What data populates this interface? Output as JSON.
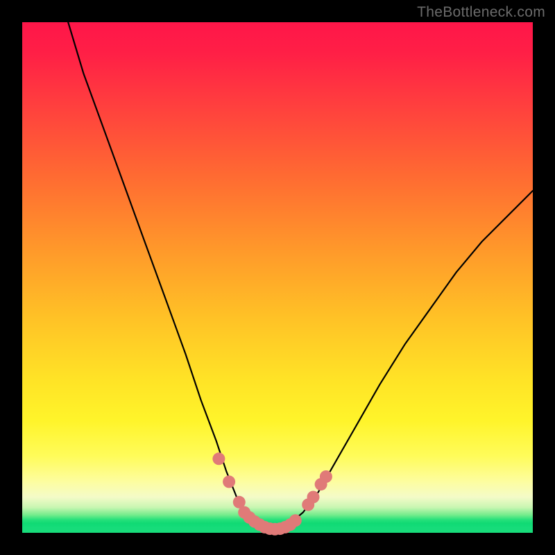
{
  "watermark": "TheBottleneck.com",
  "chart_data": {
    "type": "line",
    "title": "",
    "xlabel": "",
    "ylabel": "",
    "xlim": [
      0,
      100
    ],
    "ylim": [
      0,
      100
    ],
    "grid": false,
    "legend": false,
    "series": [
      {
        "name": "bottleneck-curve",
        "x": [
          9,
          12,
          16,
          20,
          24,
          28,
          32,
          35,
          38,
          40,
          42,
          44,
          46,
          48,
          50,
          52,
          55,
          58,
          62,
          66,
          70,
          75,
          80,
          85,
          90,
          95,
          100
        ],
        "values": [
          100,
          90,
          79,
          68,
          57,
          46,
          35,
          26,
          18,
          12,
          7,
          3.5,
          1.5,
          0.6,
          0.6,
          1.5,
          4,
          8,
          15,
          22,
          29,
          37,
          44,
          51,
          57,
          62,
          67
        ]
      }
    ],
    "markers": {
      "name": "highlighted-points",
      "color": "#e07a78",
      "points": [
        {
          "x": 38.5,
          "y": 14.5
        },
        {
          "x": 40.5,
          "y": 10
        },
        {
          "x": 42.5,
          "y": 6
        },
        {
          "x": 43.5,
          "y": 4
        },
        {
          "x": 44.5,
          "y": 3
        },
        {
          "x": 45.5,
          "y": 2.2
        },
        {
          "x": 46.5,
          "y": 1.6
        },
        {
          "x": 47.5,
          "y": 1.1
        },
        {
          "x": 48.5,
          "y": 0.8
        },
        {
          "x": 49.5,
          "y": 0.7
        },
        {
          "x": 50.5,
          "y": 0.8
        },
        {
          "x": 51.5,
          "y": 1.1
        },
        {
          "x": 52.5,
          "y": 1.6
        },
        {
          "x": 53.5,
          "y": 2.4
        },
        {
          "x": 56.0,
          "y": 5.5
        },
        {
          "x": 57.0,
          "y": 7.0
        },
        {
          "x": 58.5,
          "y": 9.5
        },
        {
          "x": 59.5,
          "y": 11
        }
      ]
    }
  }
}
